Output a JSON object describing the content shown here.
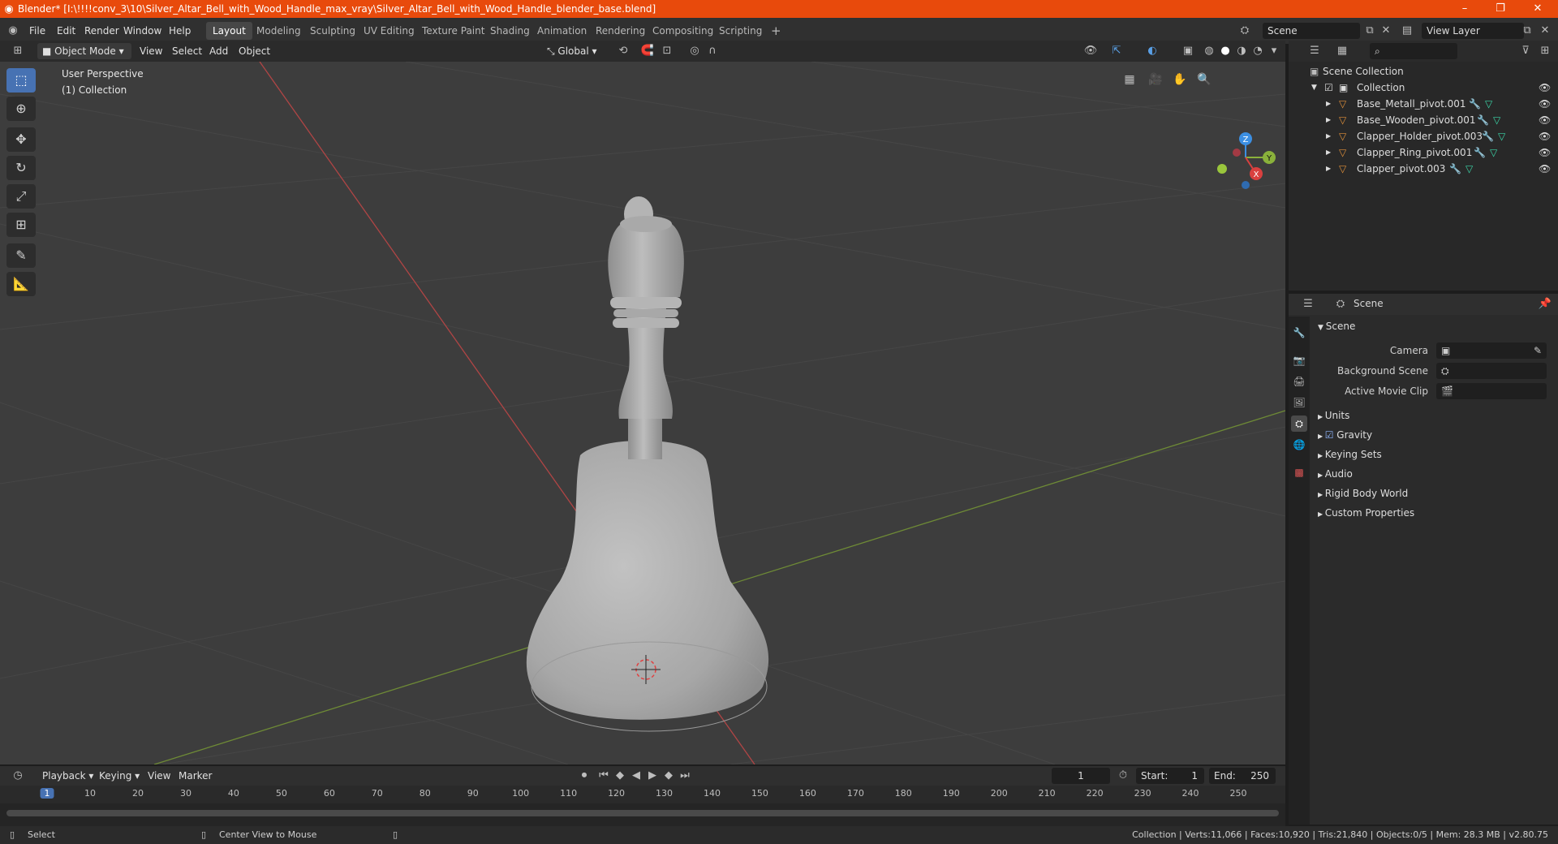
{
  "window": {
    "title": "Blender* [I:\\!!!!conv_3\\10\\Silver_Altar_Bell_with_Wood_Handle_max_vray\\Silver_Altar_Bell_with_Wood_Handle_blender_base.blend]",
    "accent": "#e84a0c"
  },
  "menu": [
    "File",
    "Edit",
    "Render",
    "Window",
    "Help"
  ],
  "workspaces": [
    "Layout",
    "Modeling",
    "Sculpting",
    "UV Editing",
    "Texture Paint",
    "Shading",
    "Animation",
    "Rendering",
    "Compositing",
    "Scripting"
  ],
  "workspace_add": "+",
  "scene_field": "Scene",
  "view_layer_field": "View Layer",
  "viewport_header": {
    "mode": "Object Mode",
    "menus": [
      "View",
      "Select",
      "Add",
      "Object"
    ],
    "transform_orientation": "Global"
  },
  "viewport": {
    "perspective_label": "User Perspective",
    "collection_label": "(1) Collection",
    "axis_colors": {
      "x": "#d9403f",
      "y": "#8ab13b",
      "z": "#3c8fe2"
    },
    "gizmo": {
      "x": "X",
      "y": "Y",
      "z": "Z"
    }
  },
  "outliner": {
    "root": "Scene Collection",
    "collection": "Collection",
    "objects": [
      "Base_Metall_pivot.001",
      "Base_Wooden_pivot.001",
      "Clapper_Holder_pivot.003",
      "Clapper_Ring_pivot.001",
      "Clapper_pivot.003"
    ]
  },
  "properties": {
    "header_title": "Scene",
    "panel_title": "Scene",
    "fields": {
      "camera": "Camera",
      "background_scene": "Background Scene",
      "active_movie_clip": "Active Movie Clip"
    },
    "sections": [
      "Units",
      "Gravity",
      "Keying Sets",
      "Audio",
      "Rigid Body World",
      "Custom Properties"
    ]
  },
  "timeline": {
    "menus": [
      "Playback",
      "Keying",
      "View",
      "Marker"
    ],
    "current_frame": "1",
    "start_label": "Start:",
    "start": "1",
    "end_label": "End:",
    "end": "250",
    "ticks": [
      "1",
      "10",
      "20",
      "30",
      "40",
      "50",
      "60",
      "70",
      "80",
      "90",
      "100",
      "110",
      "120",
      "130",
      "140",
      "150",
      "160",
      "170",
      "180",
      "190",
      "200",
      "210",
      "220",
      "230",
      "240",
      "250"
    ]
  },
  "statusbar": {
    "select": "Select",
    "center_view": "Center View to Mouse",
    "stats": "Collection | Verts:11,066 | Faces:10,920 | Tris:21,840 | Objects:0/5 | Mem: 28.3 MB | v2.80.75"
  }
}
